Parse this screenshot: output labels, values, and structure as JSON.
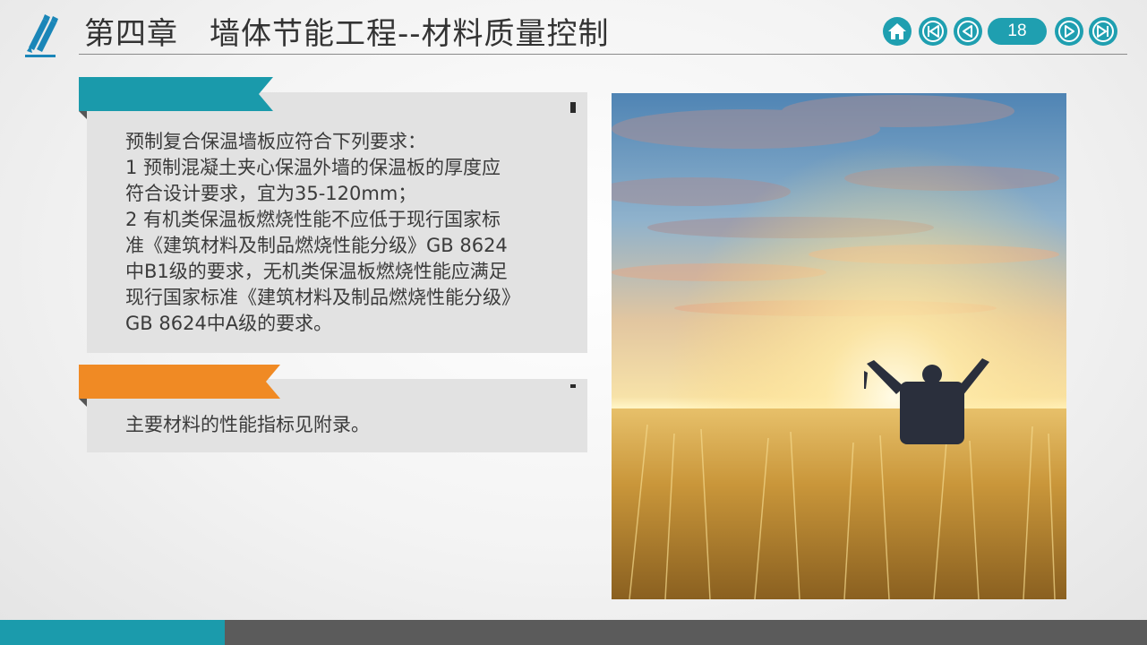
{
  "header": {
    "title": "第四章　墙体节能工程--材料质量控制",
    "logo_icon": "pencil-logo-icon"
  },
  "nav": {
    "home_icon": "home-icon",
    "first_icon": "first-page-icon",
    "prev_icon": "previous-page-icon",
    "page_number": "18",
    "next_icon": "next-page-icon",
    "last_icon": "last-page-icon"
  },
  "cards": [
    {
      "tab_color": "#1a9aab",
      "lines": [
        "预制复合保温墙板应符合下列要求：",
        "1  预制混凝土夹心保温外墙的保温板的厚度应",
        "符合设计要求，宜为35-120mm；",
        "2  有机类保温板燃烧性能不应低于现行国家标",
        "准《建筑材料及制品燃烧性能分级》GB 8624",
        "中B1级的要求，无机类保温板燃烧性能应满足",
        "现行国家标准《建筑材料及制品燃烧性能分级》",
        "GB 8624中A级的要求。"
      ]
    },
    {
      "tab_color": "#f08a24",
      "lines": [
        "主要材料的性能指标见附录。"
      ]
    }
  ],
  "photo": {
    "subject": "person-raising-arms-in-wheat-field-at-sunrise"
  },
  "colors": {
    "accent_teal": "#1f9fb0",
    "accent_orange": "#f08a24",
    "footer_dark": "#5b5b5b",
    "card_bg": "#e2e2e2"
  }
}
